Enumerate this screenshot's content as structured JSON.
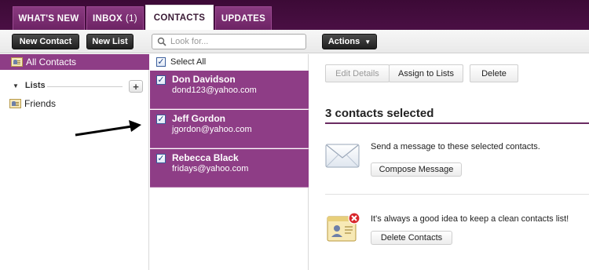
{
  "tabs": [
    {
      "label": "WHAT'S NEW",
      "count": ""
    },
    {
      "label": "INBOX",
      "count": "(1)"
    },
    {
      "label": "CONTACTS",
      "count": ""
    },
    {
      "label": "UPDATES",
      "count": ""
    }
  ],
  "toolbar": {
    "new_contact": "New Contact",
    "new_list": "New List",
    "search_placeholder": "Look for...",
    "actions": "Actions"
  },
  "sidebar": {
    "all_contacts": "All Contacts",
    "lists_header": "Lists",
    "add_label": "+",
    "lists": [
      "Friends"
    ]
  },
  "contacts": {
    "select_all": "Select All",
    "items": [
      {
        "name": "Don Davidson",
        "email": "dond123@yahoo.com"
      },
      {
        "name": "Jeff Gordon",
        "email": "jgordon@yahoo.com"
      },
      {
        "name": "Rebecca Black",
        "email": "fridays@yahoo.com"
      }
    ]
  },
  "detail": {
    "edit_details": "Edit Details",
    "assign_to_lists": "Assign to Lists",
    "delete": "Delete",
    "heading": "3 contacts selected",
    "message_text": "Send a message to these selected contacts.",
    "compose_button": "Compose Message",
    "clean_text": "It's always a good idea to keep a clean contacts list!",
    "delete_contacts_button": "Delete Contacts"
  },
  "colors": {
    "accent_purple": "#8e3d86",
    "tabbar_dark": "#4a0f44"
  }
}
